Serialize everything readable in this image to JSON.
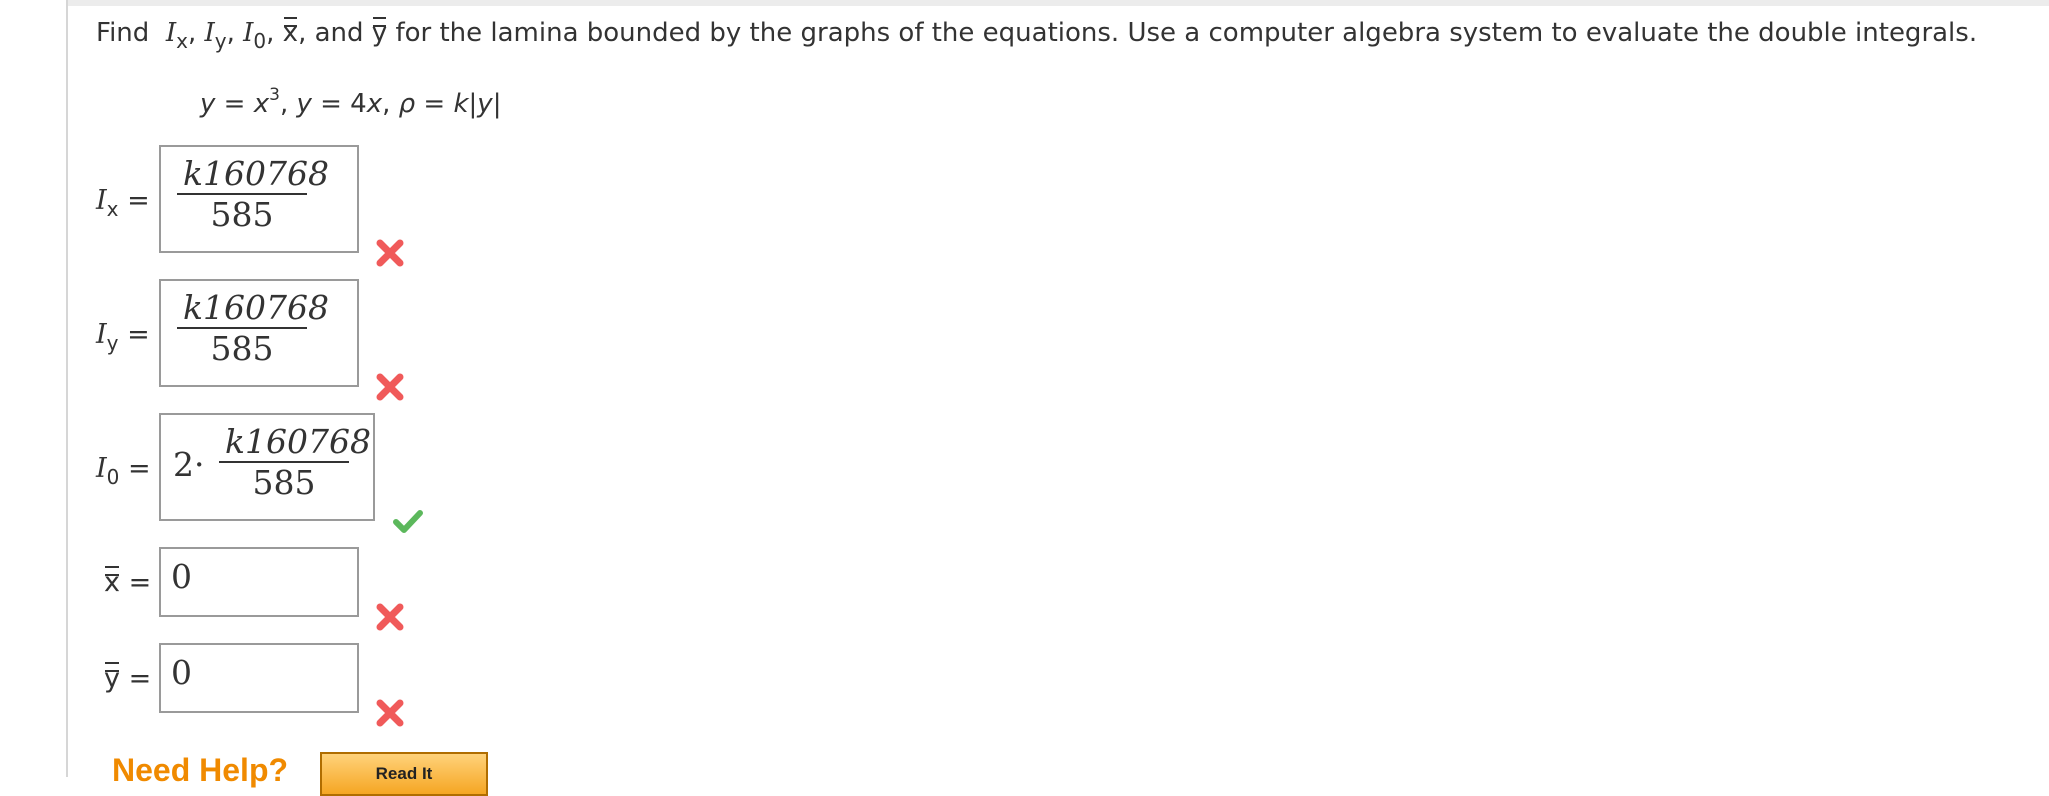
{
  "question": {
    "prefix": "Find",
    "vars": [
      "I",
      "I",
      "I"
    ],
    "subs": [
      "x",
      "y",
      "0"
    ],
    "xbar": "x",
    "and": "and",
    "ybar": "y",
    "rest": "for the lamina bounded by the graphs of the equations. Use a computer algebra system to evaluate the double integrals."
  },
  "equation": {
    "y1": "y",
    "eq1": "=",
    "x3": "x",
    "exp": "3",
    "y2": "y",
    "eq2": "= 4",
    "x2": "x",
    "rho": "ρ",
    "eq3": "=",
    "k": "k",
    "abs": "|y|"
  },
  "answers": [
    {
      "label_var": "I",
      "label_sub": "x",
      "eq": "=",
      "num": "k160768",
      "den": "585",
      "status": "incorrect"
    },
    {
      "label_var": "I",
      "label_sub": "y",
      "eq": "=",
      "num": "k160768",
      "den": "585",
      "status": "incorrect"
    },
    {
      "label_var": "I",
      "label_sub": "0",
      "eq": "=",
      "coef": "2·",
      "num": "k160768",
      "den": "585",
      "status": "correct"
    },
    {
      "label_var": "x",
      "eq": "=",
      "value": "0",
      "status": "incorrect"
    },
    {
      "label_var": "y",
      "eq": "=",
      "value": "0",
      "status": "incorrect"
    }
  ],
  "help": {
    "need_help": "Need Help?",
    "read_it": "Read It"
  },
  "colors": {
    "correct": "#5cb85c",
    "incorrect": "#f05a5a",
    "help": "#f08a00"
  }
}
